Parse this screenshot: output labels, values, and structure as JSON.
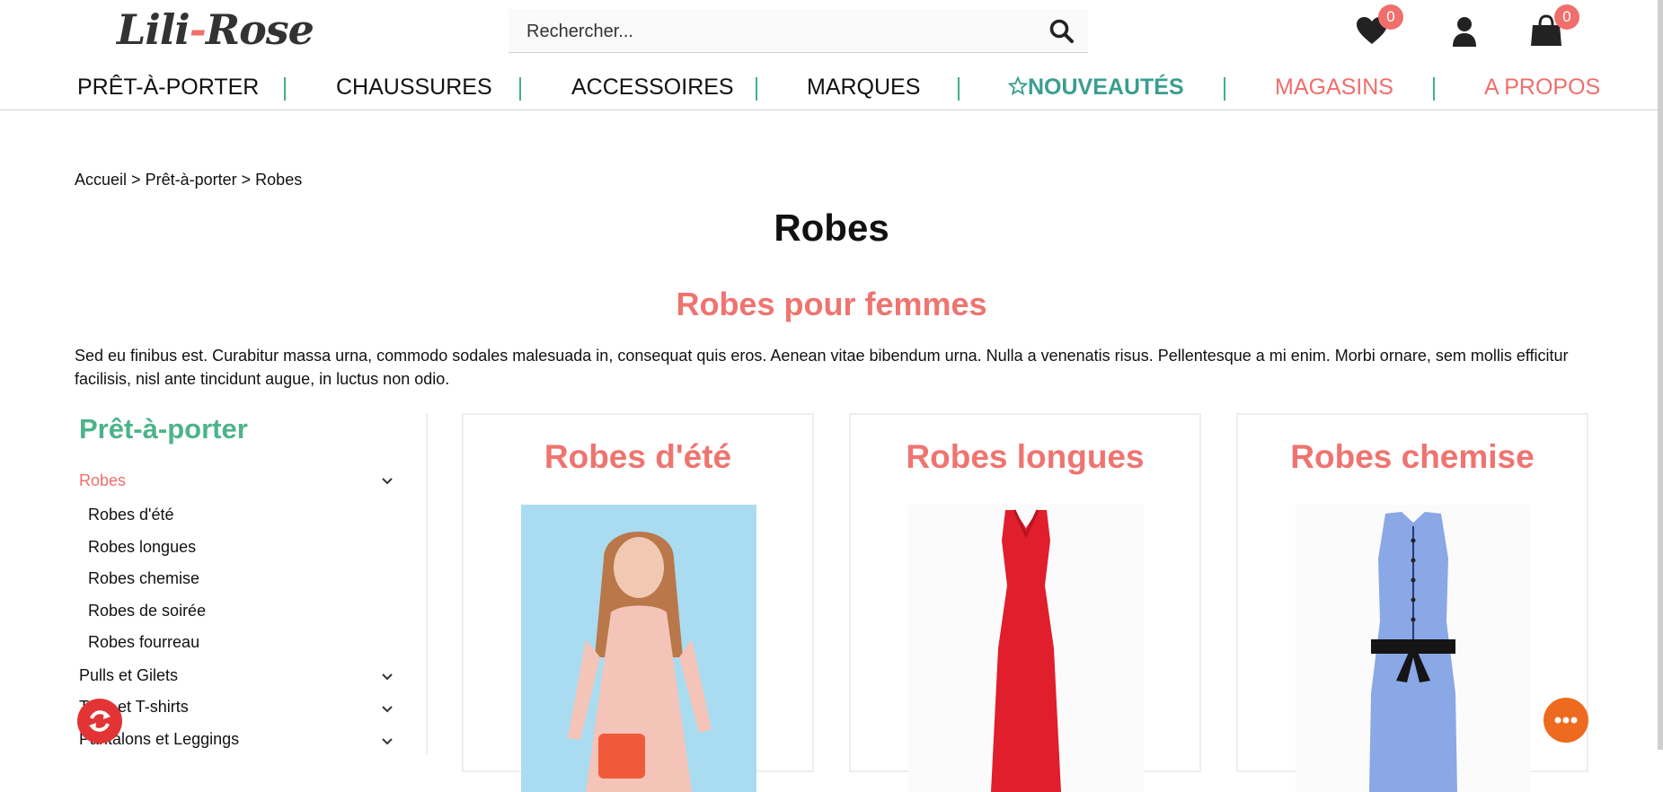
{
  "brand": {
    "logo_left": "Lili",
    "logo_dash": "-",
    "logo_right": "Rose"
  },
  "search": {
    "placeholder": "Rechercher..."
  },
  "header": {
    "wishlist_count": "0",
    "cart_count": "0"
  },
  "nav": {
    "items": [
      {
        "label": "PRÊT-À-PORTER"
      },
      {
        "label": "CHAUSSURES"
      },
      {
        "label": "ACCESSOIRES"
      },
      {
        "label": "MARQUES"
      },
      {
        "label": "NOUVEAUTÉS"
      },
      {
        "label": "MAGASINS"
      },
      {
        "label": "A PROPOS"
      }
    ]
  },
  "breadcrumb": {
    "home": "Accueil",
    "sep": ">",
    "parent": "Prêt-à-porter",
    "current": "Robes"
  },
  "page": {
    "title": "Robes",
    "subtitle": "Robes pour femmes",
    "description": "Sed eu finibus est. Curabitur massa urna, commodo sodales malesuada in, consequat quis eros. Aenean vitae bibendum urna. Nulla a venenatis risus. Pellentesque a mi enim. Morbi ornare, sem mollis efficitur facilisis, nisl ante tincidunt augue, in luctus non odio."
  },
  "sidebar": {
    "title": "Prêt-à-porter",
    "categories": [
      {
        "label": "Robes"
      },
      {
        "label": "Pulls et Gilets"
      },
      {
        "label": "Tops et T-shirts"
      },
      {
        "label": "Pantalons et Leggings"
      }
    ],
    "subcategories": [
      {
        "label": "Robes d'été"
      },
      {
        "label": "Robes longues"
      },
      {
        "label": "Robes chemise"
      },
      {
        "label": "Robes de soirée"
      },
      {
        "label": "Robes fourreau"
      }
    ]
  },
  "cards": [
    {
      "title": "Robes d'été"
    },
    {
      "title": "Robes longues"
    },
    {
      "title": "Robes chemise"
    }
  ],
  "colors": {
    "accent_coral": "#ef6f6c",
    "accent_green": "#4cb38a",
    "accent_teal": "#3a9e8f"
  }
}
